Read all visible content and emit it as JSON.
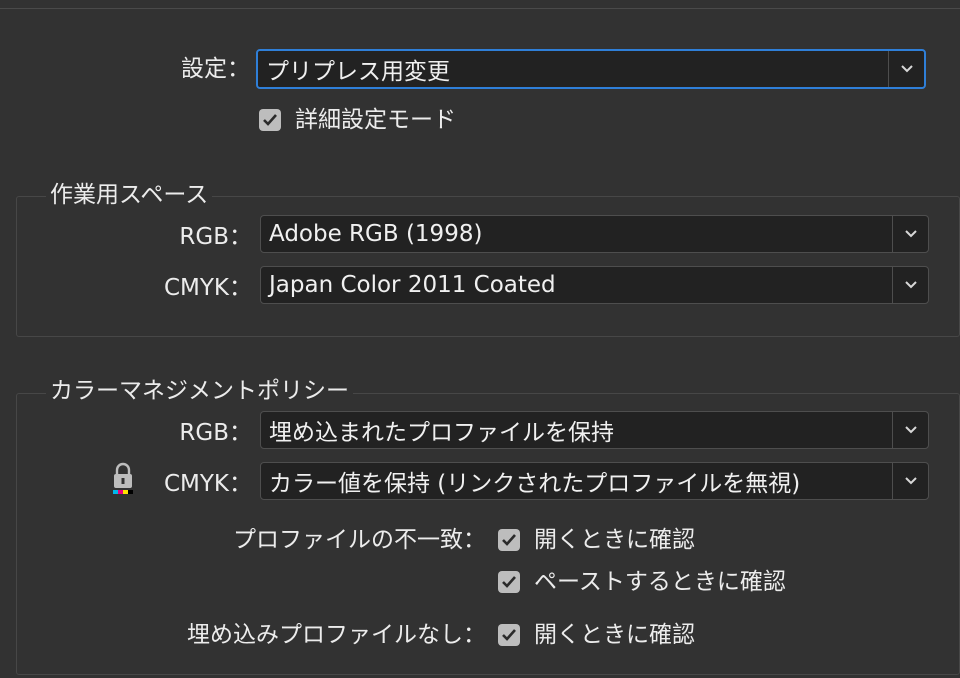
{
  "settings": {
    "label": "設定：",
    "value": "プリプレス用変更",
    "advanced_mode_label": "詳細設定モード",
    "advanced_mode_checked": true
  },
  "working_spaces": {
    "title": "作業用スペース",
    "rgb_label": "RGB：",
    "rgb_value": "Adobe RGB (1998)",
    "cmyk_label": "CMYK：",
    "cmyk_value": "Japan Color 2011 Coated"
  },
  "color_policy": {
    "title": "カラーマネジメントポリシー",
    "rgb_label": "RGB：",
    "rgb_value": "埋め込まれたプロファイルを保持",
    "cmyk_label": "CMYK：",
    "cmyk_value": "カラー値を保持 (リンクされたプロファイルを無視)",
    "mismatch_label": "プロファイルの不一致：",
    "ask_open_label": "開くときに確認",
    "ask_paste_label": "ペーストするときに確認",
    "missing_label": "埋め込みプロファイルなし：",
    "missing_ask_open_label": "開くときに確認"
  },
  "icons": {
    "dropdown": "chevron-down-icon",
    "check": "checkmark-icon",
    "lock": "lock-icon"
  },
  "colors": {
    "focus": "#2f7fd8",
    "cyan": "#00b7eb",
    "magenta": "#e6007e",
    "yellow": "#ffe100",
    "black": "#000000"
  }
}
